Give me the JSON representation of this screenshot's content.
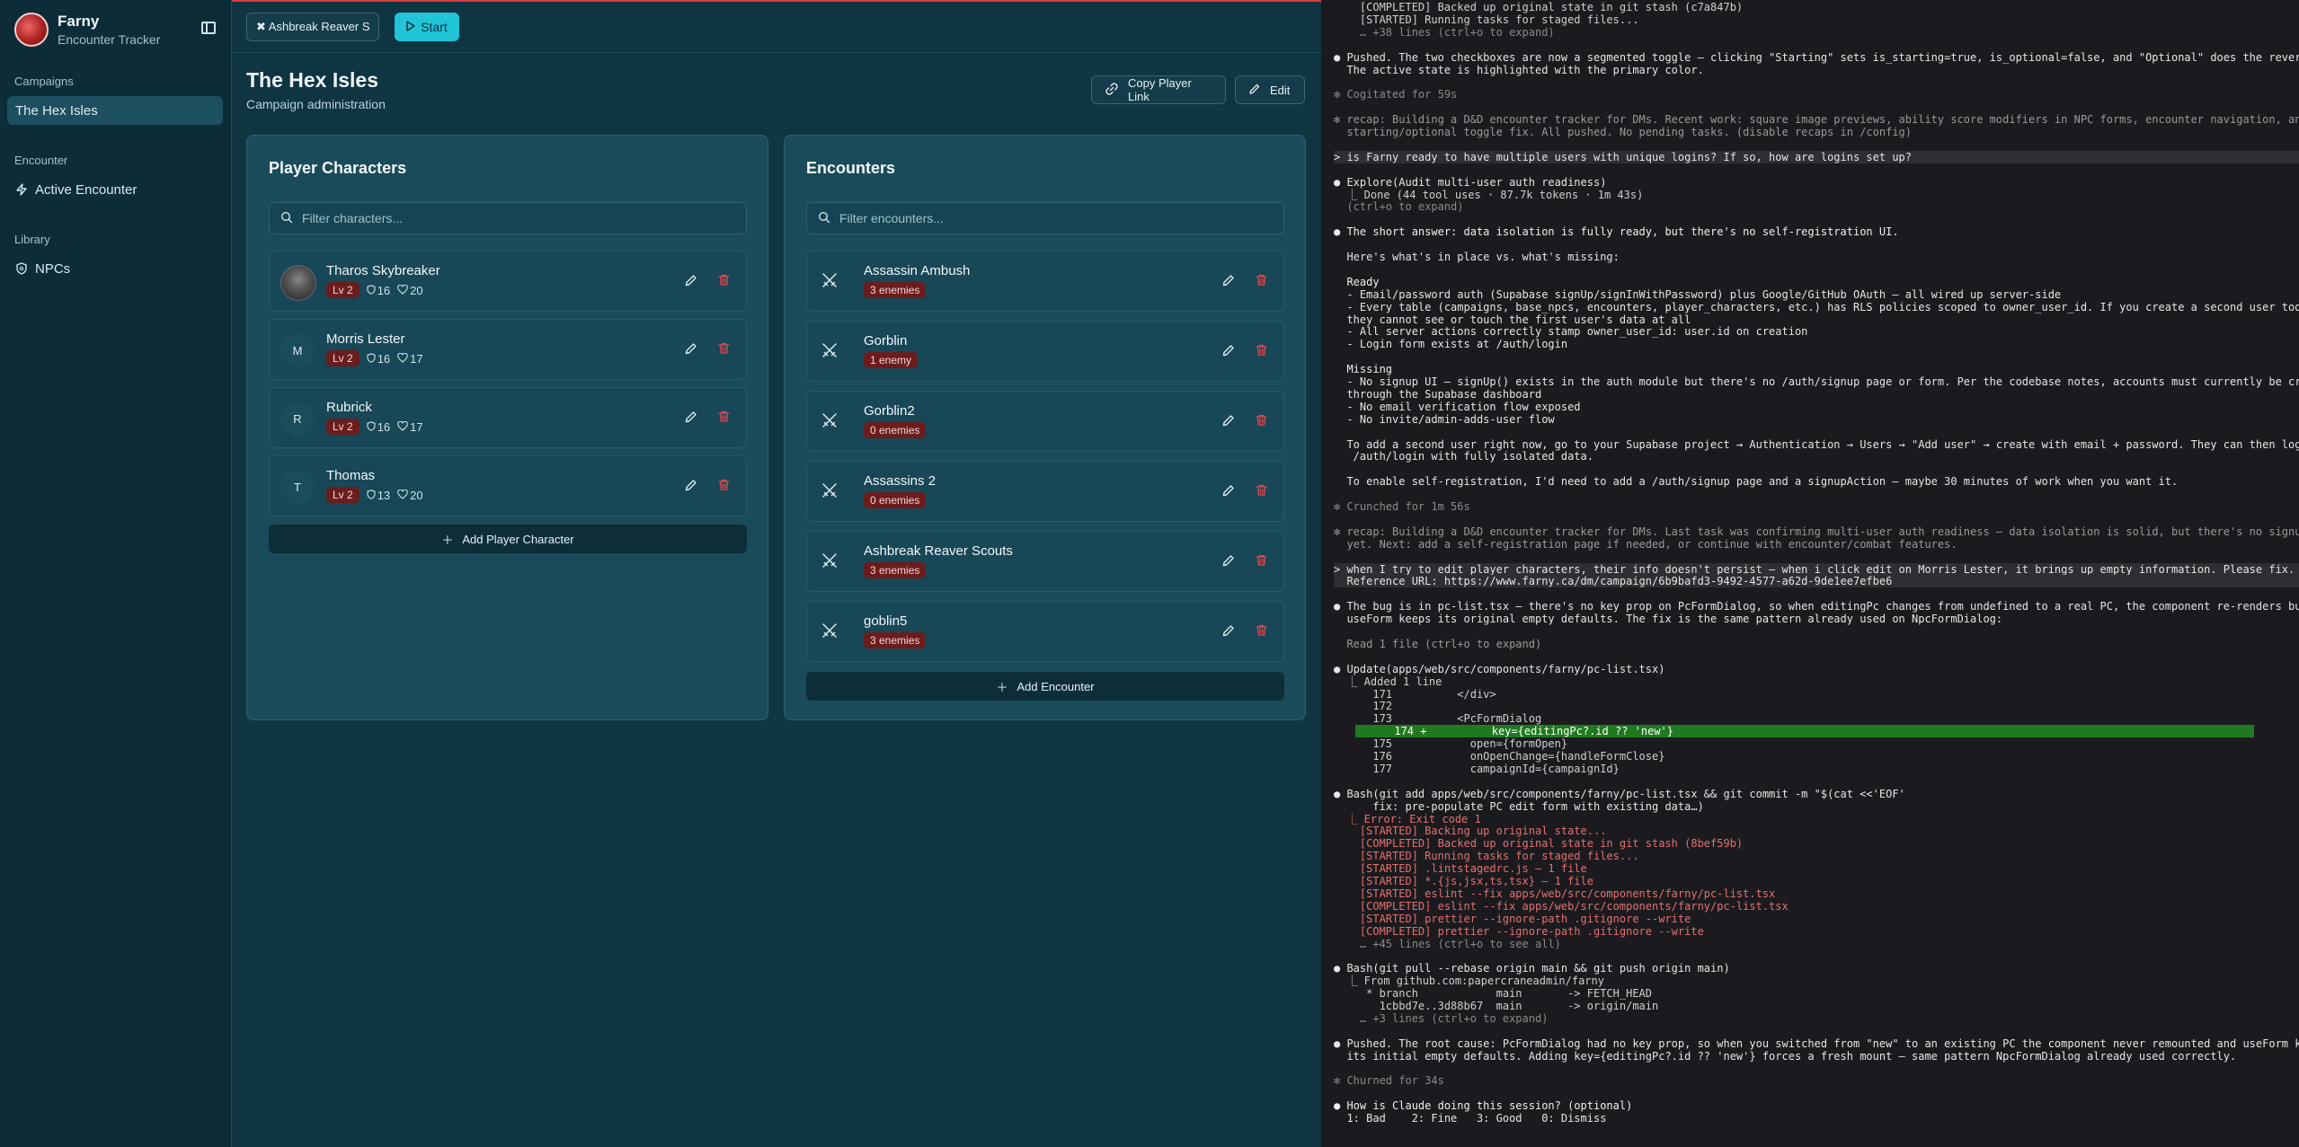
{
  "colors": {
    "accent": "#22c4d8",
    "danger": "#e5484d",
    "sidebar_bg": "#0c2c38",
    "panel_bg": "#1a4b5a",
    "terminal_bg": "#1b1b1f"
  },
  "app": {
    "name": "Farny",
    "subtitle": "Encounter Tracker"
  },
  "sidebar": {
    "sections": [
      {
        "title": "Campaigns",
        "items": [
          {
            "label": "The Hex Isles",
            "icon": "",
            "active": true
          }
        ]
      },
      {
        "title": "Encounter",
        "items": [
          {
            "label": "Active Encounter",
            "icon": "zap-icon",
            "active": false
          }
        ]
      },
      {
        "title": "Library",
        "items": [
          {
            "label": "NPCs",
            "icon": "shield-icon",
            "active": false
          }
        ]
      }
    ]
  },
  "topbar": {
    "encounter_select": "✖ Ashbreak Reaver S",
    "start_label": "Start"
  },
  "header": {
    "title": "The Hex Isles",
    "subtitle": "Campaign administration",
    "copy_link_label": "Copy Player Link",
    "edit_label": "Edit"
  },
  "players": {
    "title": "Player Characters",
    "filter_placeholder": "Filter characters...",
    "add_label": "Add Player Character",
    "rows": [
      {
        "name": "Tharos Skybreaker",
        "avatar": "",
        "level": "Lv 2",
        "ac": "16",
        "hp": "20"
      },
      {
        "name": "Morris Lester",
        "avatar": "M",
        "level": "Lv 2",
        "ac": "16",
        "hp": "17"
      },
      {
        "name": "Rubrick",
        "avatar": "R",
        "level": "Lv 2",
        "ac": "16",
        "hp": "17"
      },
      {
        "name": "Thomas",
        "avatar": "T",
        "level": "Lv 2",
        "ac": "13",
        "hp": "20"
      }
    ]
  },
  "encounters": {
    "title": "Encounters",
    "filter_placeholder": "Filter encounters...",
    "add_label": "Add Encounter",
    "rows": [
      {
        "name": "Assassin Ambush",
        "badge": "3 enemies"
      },
      {
        "name": "Gorblin",
        "badge": "1 enemy"
      },
      {
        "name": "Gorblin2",
        "badge": "0 enemies"
      },
      {
        "name": "Assassins 2",
        "badge": "0 enemies"
      },
      {
        "name": "Ashbreak Reaver Scouts",
        "badge": "3 enemies"
      },
      {
        "name": "goblin5",
        "badge": "3 enemies"
      }
    ]
  },
  "terminal": {
    "lines": [
      {
        "text": "    [COMPLETED] Backed up original state in git stash (c7a847b)",
        "color": "#d0d0d0"
      },
      {
        "text": "    [STARTED] Running tasks for staged files...",
        "color": "#d0d0d0"
      },
      {
        "text": "    … +38 lines (ctrl+o to expand)",
        "color": "#8a8a8a"
      },
      {
        "text": "",
        "color": "#d0d0d0"
      },
      {
        "text": "● Pushed. The two checkboxes are now a segmented toggle — clicking \"Starting\" sets is_starting=true, is_optional=false, and \"Optional\" does the reverse.",
        "color": "#e6e6e6"
      },
      {
        "text": "  The active state is highlighted with the primary color.",
        "color": "#e6e6e6"
      },
      {
        "text": "",
        "color": "#d0d0d0"
      },
      {
        "text": "✻ Cogitated for 59s",
        "color": "#8a8a8a"
      },
      {
        "text": "",
        "color": "#d0d0d0"
      },
      {
        "text": "✻ recap: Building a D&D encounter tracker for DMs. Recent work: square image previews, ability score modifiers in NPC forms, encounter navigation, and",
        "color": "#9a9a9a"
      },
      {
        "text": "  starting/optional toggle fix. All pushed. No pending tasks. (disable recaps in /config)",
        "color": "#9a9a9a"
      },
      {
        "text": "",
        "color": "#d0d0d0"
      },
      {
        "text": "> is Farny ready to have multiple users with unique logins? If so, how are logins set up?",
        "color": "#e6e6e6",
        "highlight": true
      },
      {
        "text": "",
        "color": "#d0d0d0"
      },
      {
        "text": "● Explore(Audit multi-user auth readiness)",
        "color": "#e6e6e6"
      },
      {
        "text": "  ⎿ Done (44 tool uses · 87.7k tokens · 1m 43s)",
        "color": "#d0d0d0"
      },
      {
        "text": "  (ctrl+o to expand)",
        "color": "#8a8a8a"
      },
      {
        "text": "",
        "color": "#d0d0d0"
      },
      {
        "text": "● The short answer: data isolation is fully ready, but there's no self-registration UI.",
        "color": "#f0f0f0"
      },
      {
        "text": "",
        "color": "#d0d0d0"
      },
      {
        "text": "  Here's what's in place vs. what's missing:",
        "color": "#e6e6e6"
      },
      {
        "text": "",
        "color": "#d0d0d0"
      },
      {
        "text": "  Ready",
        "color": "#f0f0f0"
      },
      {
        "text": "  - Email/password auth (Supabase signUp/signInWithPassword) plus Google/GitHub OAuth — all wired up server-side",
        "color": "#e6e6e6"
      },
      {
        "text": "  - Every table (campaigns, base_npcs, encounters, player_characters, etc.) has RLS policies scoped to owner_user_id. If you create a second user today,",
        "color": "#e6e6e6"
      },
      {
        "text": "  they cannot see or touch the first user's data at all",
        "color": "#e6e6e6"
      },
      {
        "text": "  - All server actions correctly stamp owner_user_id: user.id on creation",
        "color": "#e6e6e6"
      },
      {
        "text": "  - Login form exists at /auth/login",
        "color": "#e6e6e6"
      },
      {
        "text": "",
        "color": "#d0d0d0"
      },
      {
        "text": "  Missing",
        "color": "#f0f0f0"
      },
      {
        "text": "  - No signup UI — signUp() exists in the auth module but there's no /auth/signup page or form. Per the codebase notes, accounts must currently be created",
        "color": "#e6e6e6"
      },
      {
        "text": "  through the Supabase dashboard",
        "color": "#e6e6e6"
      },
      {
        "text": "  - No email verification flow exposed",
        "color": "#e6e6e6"
      },
      {
        "text": "  - No invite/admin-adds-user flow",
        "color": "#e6e6e6"
      },
      {
        "text": "",
        "color": "#d0d0d0"
      },
      {
        "text": "  To add a second user right now, go to your Supabase project → Authentication → Users → \"Add user\" → create with email + password. They can then log in at",
        "color": "#e6e6e6"
      },
      {
        "text": "   /auth/login with fully isolated data.",
        "color": "#e6e6e6"
      },
      {
        "text": "",
        "color": "#d0d0d0"
      },
      {
        "text": "  To enable self-registration, I'd need to add a /auth/signup page and a signupAction — maybe 30 minutes of work when you want it.",
        "color": "#e6e6e6"
      },
      {
        "text": "",
        "color": "#d0d0d0"
      },
      {
        "text": "✻ Crunched for 1m 56s",
        "color": "#8a8a8a"
      },
      {
        "text": "",
        "color": "#d0d0d0"
      },
      {
        "text": "✻ recap: Building a D&D encounter tracker for DMs. Last task was confirming multi-user auth readiness — data isolation is solid, but there's no signup UI",
        "color": "#9a9a9a"
      },
      {
        "text": "  yet. Next: add a self-registration page if needed, or continue with encounter/combat features.",
        "color": "#9a9a9a"
      },
      {
        "text": "",
        "color": "#d0d0d0"
      },
      {
        "text": "> when I try to edit player characters, their info doesn't persist — when i click edit on Morris Lester, it brings up empty information. Please fix.",
        "color": "#e6e6e6",
        "highlight": true
      },
      {
        "text": "  Reference URL: https://www.farny.ca/dm/campaign/6b9bafd3-9492-4577-a62d-9de1ee7efbe6",
        "color": "#e6e6e6",
        "highlight": true
      },
      {
        "text": "",
        "color": "#d0d0d0"
      },
      {
        "text": "● The bug is in pc-list.tsx — there's no key prop on PcFormDialog, so when editingPc changes from undefined to a real PC, the component re-renders but",
        "color": "#e6e6e6"
      },
      {
        "text": "  useForm keeps its original empty defaults. The fix is the same pattern already used on NpcFormDialog:",
        "color": "#e6e6e6"
      },
      {
        "text": "",
        "color": "#d0d0d0"
      },
      {
        "text": "  Read 1 file (ctrl+o to expand)",
        "color": "#9a9a9a"
      },
      {
        "text": "",
        "color": "#d0d0d0"
      },
      {
        "text": "● Update(apps/web/src/components/farny/pc-list.tsx)",
        "color": "#e6e6e6"
      },
      {
        "text": "  ⎿ Added 1 line",
        "color": "#d0d0d0"
      },
      {
        "text": "      171          </div>",
        "color": "#d0d0d0"
      },
      {
        "text": "      172",
        "color": "#d0d0d0"
      },
      {
        "text": "      173          <PcFormDialog",
        "color": "#d0d0d0"
      },
      {
        "text": "      174 +          key={editingPc?.id ?? 'new'}",
        "color": "#ffffff",
        "added": true
      },
      {
        "text": "      175            open={formOpen}",
        "color": "#d0d0d0"
      },
      {
        "text": "      176            onOpenChange={handleFormClose}",
        "color": "#d0d0d0"
      },
      {
        "text": "      177            campaignId={campaignId}",
        "color": "#d0d0d0"
      },
      {
        "text": "",
        "color": "#d0d0d0"
      },
      {
        "text": "● Bash(git add apps/web/src/components/farny/pc-list.tsx && git commit -m \"$(cat <<'EOF'",
        "color": "#e6e6e6"
      },
      {
        "text": "      fix: pre-populate PC edit form with existing data…)",
        "color": "#e6e6e6"
      },
      {
        "text": "  ⎿ Error: Exit code 1",
        "color": "#e5706f"
      },
      {
        "text": "    [STARTED] Backing up original state...",
        "color": "#e5706f"
      },
      {
        "text": "    [COMPLETED] Backed up original state in git stash (8bef59b)",
        "color": "#e5706f"
      },
      {
        "text": "    [STARTED] Running tasks for staged files...",
        "color": "#e5706f"
      },
      {
        "text": "    [STARTED] .lintstagedrc.js — 1 file",
        "color": "#e5706f"
      },
      {
        "text": "    [STARTED] *.{js,jsx,ts,tsx} — 1 file",
        "color": "#e5706f"
      },
      {
        "text": "    [STARTED] eslint --fix apps/web/src/components/farny/pc-list.tsx",
        "color": "#e5706f"
      },
      {
        "text": "    [COMPLETED] eslint --fix apps/web/src/components/farny/pc-list.tsx",
        "color": "#e5706f"
      },
      {
        "text": "    [STARTED] prettier --ignore-path .gitignore --write",
        "color": "#e5706f"
      },
      {
        "text": "    [COMPLETED] prettier --ignore-path .gitignore --write",
        "color": "#e5706f"
      },
      {
        "text": "    … +45 lines (ctrl+o to see all)",
        "color": "#8a8a8a"
      },
      {
        "text": "",
        "color": "#d0d0d0"
      },
      {
        "text": "● Bash(git pull --rebase origin main && git push origin main)",
        "color": "#e6e6e6"
      },
      {
        "text": "  ⎿ From github.com:papercraneadmin/farny",
        "color": "#d0d0d0"
      },
      {
        "text": "     * branch            main       -> FETCH_HEAD",
        "color": "#d0d0d0"
      },
      {
        "text": "       1cbbd7e..3d88b67  main       -> origin/main",
        "color": "#d0d0d0"
      },
      {
        "text": "    … +3 lines (ctrl+o to expand)",
        "color": "#8a8a8a"
      },
      {
        "text": "",
        "color": "#d0d0d0"
      },
      {
        "text": "● Pushed. The root cause: PcFormDialog had no key prop, so when you switched from \"new\" to an existing PC the component never remounted and useForm kept",
        "color": "#e6e6e6"
      },
      {
        "text": "  its initial empty defaults. Adding key={editingPc?.id ?? 'new'} forces a fresh mount — same pattern NpcFormDialog already used correctly.",
        "color": "#e6e6e6"
      },
      {
        "text": "",
        "color": "#d0d0d0"
      },
      {
        "text": "✻ Churned for 34s",
        "color": "#8a8a8a"
      },
      {
        "text": "",
        "color": "#d0d0d0"
      },
      {
        "text": "● How is Claude doing this session? (optional)",
        "color": "#f0f0f0"
      },
      {
        "text": "  1: Bad    2: Fine   3: Good   0: Dismiss",
        "color": "#e6e6e6"
      }
    ]
  }
}
